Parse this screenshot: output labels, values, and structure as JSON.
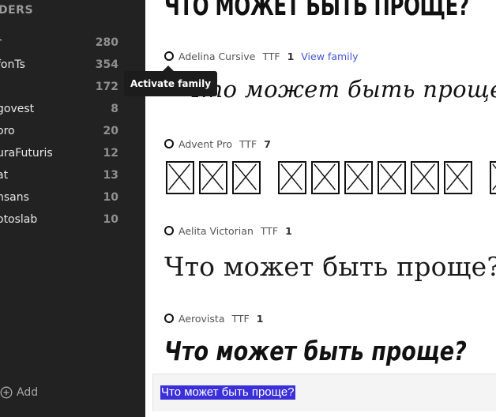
{
  "sidebar": {
    "heading": "DERS",
    "folders": [
      {
        "name": "r",
        "count": "280"
      },
      {
        "name": "fonTs",
        "count": "354"
      },
      {
        "name": "",
        "count": "172"
      },
      {
        "name": "govest",
        "count": "8"
      },
      {
        "name": "oro",
        "count": "20"
      },
      {
        "name": "uraFuturis",
        "count": "12"
      },
      {
        "name": "at",
        "count": "13"
      },
      {
        "name": "nsans",
        "count": "10"
      },
      {
        "name": "otoslab",
        "count": "10"
      }
    ],
    "add_label": "Add",
    "add_icon": "plus-circle-icon"
  },
  "main": {
    "top_preview": "ЧТО МОЖЕТ БЫТЬ ПРОЩЕ?",
    "fonts": [
      {
        "name": "Adelina Cursive",
        "format": "TTF",
        "count": "1",
        "link": "View family",
        "preview": "Что может быть проще?"
      },
      {
        "name": "Advent Pro",
        "format": "TTF",
        "count": "7",
        "preview": ""
      },
      {
        "name": "Aelita Victorian",
        "format": "TTF",
        "count": "1",
        "preview": "Что может быть проще?"
      },
      {
        "name": "Aerovista",
        "format": "TTF",
        "count": "1",
        "preview": "Что может быть проще?"
      }
    ],
    "tooltip": "Activate family",
    "input_value": "Что может быть проще?"
  },
  "colors": {
    "sidebar_bg": "#222222",
    "link": "#4055d6",
    "selection": "#3b2fd9"
  }
}
